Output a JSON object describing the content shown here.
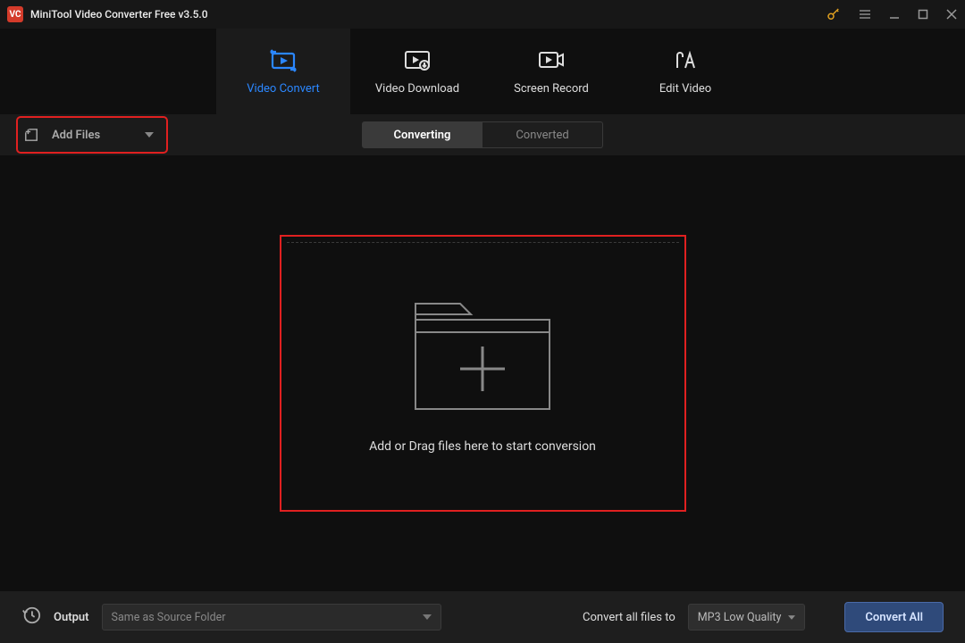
{
  "app": {
    "title": "MiniTool Video Converter Free v3.5.0",
    "logo_text": "VC"
  },
  "main_tabs": {
    "video_convert": "Video Convert",
    "video_download": "Video Download",
    "screen_record": "Screen Record",
    "edit_video": "Edit Video"
  },
  "toolbar": {
    "add_files": "Add Files",
    "converting": "Converting",
    "converted": "Converted"
  },
  "drop_zone": {
    "text": "Add or Drag files here to start conversion"
  },
  "footer": {
    "output_label": "Output",
    "output_value": "Same as Source Folder",
    "convert_all_label": "Convert all files to",
    "format_value": "MP3 Low Quality",
    "convert_all_button": "Convert All"
  }
}
